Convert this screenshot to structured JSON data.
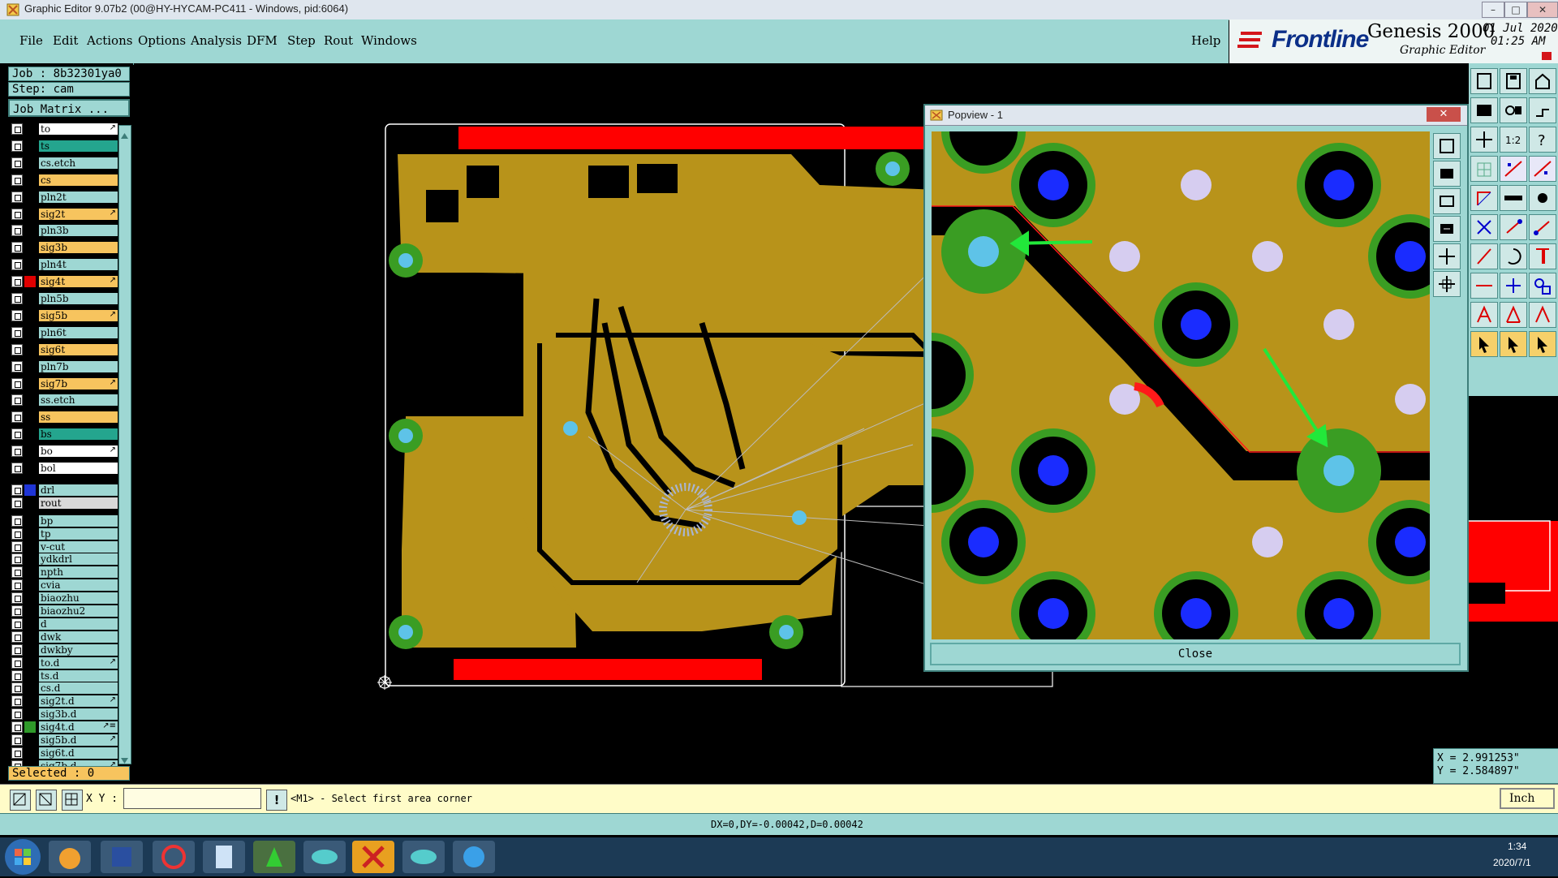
{
  "window": {
    "title": "Graphic Editor 9.07b2 (00@HY-HYCAM-PC411 - Windows, pid:6064)"
  },
  "menu": [
    "File",
    "Edit",
    "Actions",
    "Options",
    "Analysis",
    "DFM",
    "Step",
    "Rout",
    "Windows"
  ],
  "help_label": "Help",
  "brand": {
    "logo_text": "Frontline",
    "product": "Genesis 2000",
    "subtitle": "Graphic Editor",
    "date": "01 Jul 2020",
    "time": "01:25 AM"
  },
  "job": {
    "job_label": "Job : 8b32301ya0",
    "step_label": "Step: cam",
    "matrix_button": "Job Matrix ..."
  },
  "layers": [
    {
      "name": "to",
      "bg": "#ffffff",
      "marker": "",
      "flag": "↗"
    },
    {
      "name": "ts",
      "bg": "#24a58e",
      "marker": "",
      "flag": ""
    },
    {
      "name": "cs.etch",
      "bg": "#9ed7d3",
      "marker": "",
      "flag": ""
    },
    {
      "name": "cs",
      "bg": "#f7c45e",
      "marker": "",
      "flag": ""
    },
    {
      "name": "pln2t",
      "bg": "#9ed7d3",
      "marker": "",
      "flag": ""
    },
    {
      "name": "sig2t",
      "bg": "#f7c45e",
      "marker": "",
      "flag": "↗"
    },
    {
      "name": "pln3b",
      "bg": "#9ed7d3",
      "marker": "",
      "flag": ""
    },
    {
      "name": "sig3b",
      "bg": "#f7c45e",
      "marker": "",
      "flag": ""
    },
    {
      "name": "pln4t",
      "bg": "#9ed7d3",
      "marker": "",
      "flag": ""
    },
    {
      "name": "sig4t",
      "bg": "#f7c45e",
      "marker": "#e00000",
      "flag": "↗"
    },
    {
      "name": "pln5b",
      "bg": "#9ed7d3",
      "marker": "",
      "flag": ""
    },
    {
      "name": "sig5b",
      "bg": "#f7c45e",
      "marker": "",
      "flag": "↗"
    },
    {
      "name": "pln6t",
      "bg": "#9ed7d3",
      "marker": "",
      "flag": ""
    },
    {
      "name": "sig6t",
      "bg": "#f7c45e",
      "marker": "",
      "flag": ""
    },
    {
      "name": "pln7b",
      "bg": "#9ed7d3",
      "marker": "",
      "flag": ""
    },
    {
      "name": "sig7b",
      "bg": "#f7c45e",
      "marker": "",
      "flag": "↗"
    },
    {
      "name": "ss.etch",
      "bg": "#9ed7d3",
      "marker": "",
      "flag": ""
    },
    {
      "name": "ss",
      "bg": "#f7c45e",
      "marker": "",
      "flag": ""
    },
    {
      "name": "bs",
      "bg": "#24a58e",
      "marker": "",
      "flag": ""
    },
    {
      "name": "bo",
      "bg": "#ffffff",
      "marker": "",
      "flag": "↗"
    },
    {
      "name": "bol",
      "bg": "#ffffff",
      "marker": "",
      "flag": ""
    },
    {
      "name": "drl",
      "bg": "#9ed7d3",
      "marker": "#1f35d6",
      "flag": ""
    },
    {
      "name": "rout",
      "bg": "#d8d8d8",
      "marker": "",
      "flag": ""
    },
    {
      "name": "bp",
      "bg": "#9ed7d3",
      "marker": "",
      "flag": ""
    },
    {
      "name": "tp",
      "bg": "#9ed7d3",
      "marker": "",
      "flag": ""
    },
    {
      "name": "v-cut",
      "bg": "#9ed7d3",
      "marker": "",
      "flag": ""
    },
    {
      "name": "ydkdrl",
      "bg": "#9ed7d3",
      "marker": "",
      "flag": ""
    },
    {
      "name": "npth",
      "bg": "#9ed7d3",
      "marker": "",
      "flag": ""
    },
    {
      "name": "cvia",
      "bg": "#9ed7d3",
      "marker": "",
      "flag": ""
    },
    {
      "name": "biaozhu",
      "bg": "#9ed7d3",
      "marker": "",
      "flag": ""
    },
    {
      "name": "biaozhu2",
      "bg": "#9ed7d3",
      "marker": "",
      "flag": ""
    },
    {
      "name": "d",
      "bg": "#9ed7d3",
      "marker": "",
      "flag": ""
    },
    {
      "name": "dwk",
      "bg": "#9ed7d3",
      "marker": "",
      "flag": ""
    },
    {
      "name": "dwkby",
      "bg": "#9ed7d3",
      "marker": "",
      "flag": ""
    },
    {
      "name": "to.d",
      "bg": "#9ed7d3",
      "marker": "",
      "flag": "↗"
    },
    {
      "name": "ts.d",
      "bg": "#9ed7d3",
      "marker": "",
      "flag": ""
    },
    {
      "name": "cs.d",
      "bg": "#9ed7d3",
      "marker": "",
      "flag": ""
    },
    {
      "name": "sig2t.d",
      "bg": "#9ed7d3",
      "marker": "",
      "flag": "↗"
    },
    {
      "name": "sig3b.d",
      "bg": "#9ed7d3",
      "marker": "",
      "flag": ""
    },
    {
      "name": "sig4t.d",
      "bg": "#9ed7d3",
      "marker": "#2f9a2a",
      "flag": "↗≡"
    },
    {
      "name": "sig5b.d",
      "bg": "#9ed7d3",
      "marker": "",
      "flag": "↗"
    },
    {
      "name": "sig6t.d",
      "bg": "#9ed7d3",
      "marker": "",
      "flag": ""
    },
    {
      "name": "sig7b.d",
      "bg": "#9ed7d3",
      "marker": "",
      "flag": "↗"
    }
  ],
  "selected_label": "Selected : 0",
  "popview": {
    "title": "Popview - 1",
    "close_label": "Close"
  },
  "coords": {
    "x": "X = 2.991253\"",
    "y": "Y = 2.584897\""
  },
  "command": {
    "xy_label": "X Y :",
    "input_value": "",
    "prompt": "<M1> - Select first area corner",
    "units": "Inch"
  },
  "status": {
    "text": "DX=0,DY=-0.00042,D=0.00042"
  },
  "taskbar": {
    "time": "1:34",
    "date": "2020/7/1"
  },
  "colors": {
    "teal_panel": "#9ed7d3",
    "board_copper": "#b8931a",
    "outline_red": "#ff0000",
    "pad_green": "#3a9d23",
    "drill_blue": "#1a2cff",
    "via_light": "#d6cdf0",
    "arrow_green": "#22e83a"
  }
}
